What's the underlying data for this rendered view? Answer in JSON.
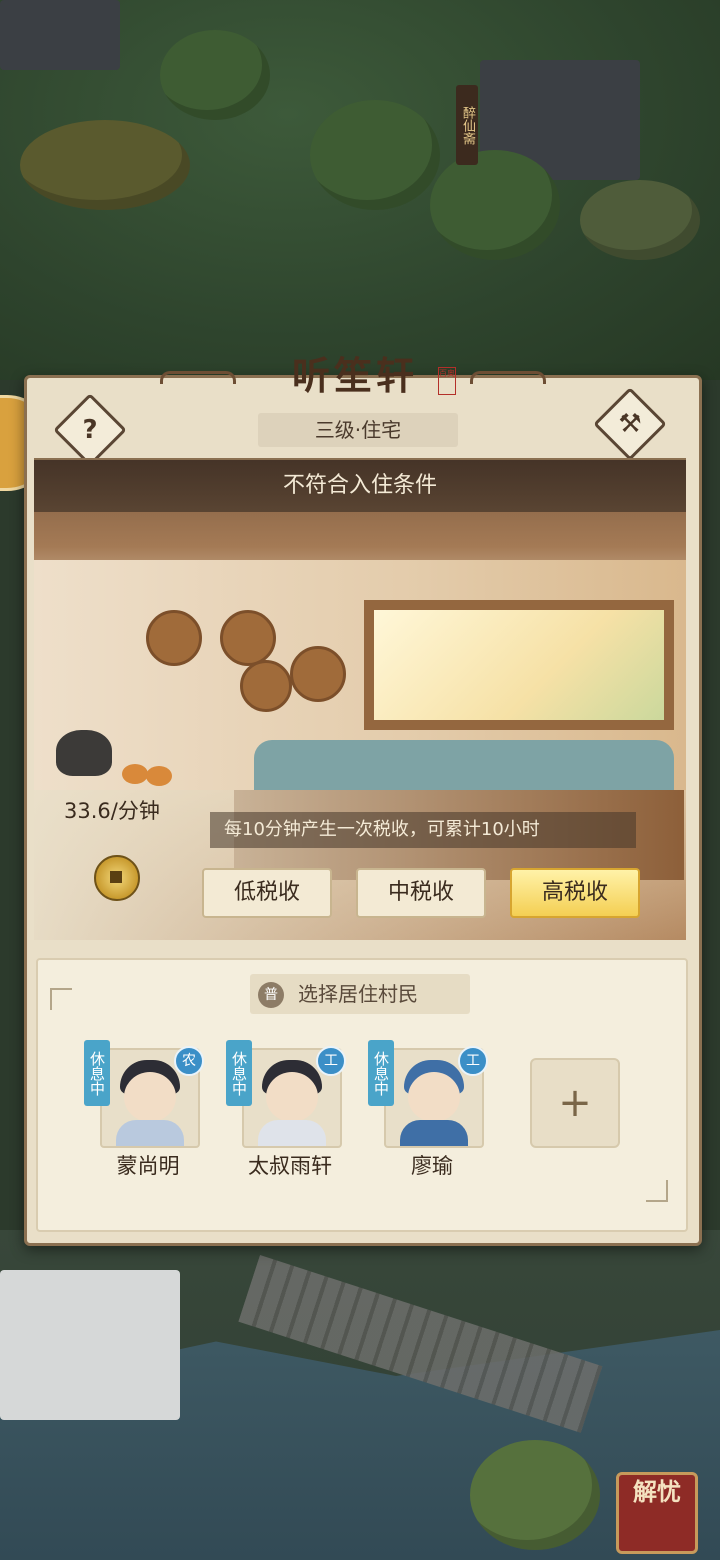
{
  "building": {
    "name": "听笙轩",
    "seal_text": "百奥",
    "level_type": "三级·住宅",
    "status": "不符合入住条件"
  },
  "buttons": {
    "help_symbol": "?",
    "build_symbol": "⚒"
  },
  "map": {
    "sign_text": "醉仙斋"
  },
  "tax": {
    "rate_label": "33.6/分钟",
    "note": "每10分钟产生一次税收，可累计10小时",
    "options": [
      {
        "label": "低税收",
        "selected": false
      },
      {
        "label": "中税收",
        "selected": false
      },
      {
        "label": "高税收",
        "selected": true
      }
    ]
  },
  "residents": {
    "header_badge": "普",
    "header": "选择居住村民",
    "list": [
      {
        "name": "蒙尚明",
        "status": "休息中",
        "job": "农"
      },
      {
        "name": "太叔雨轩",
        "status": "休息中",
        "job": "工"
      },
      {
        "name": "廖瑜",
        "status": "休息中",
        "job": "工"
      }
    ],
    "add_symbol": "+"
  },
  "corner_badge": {
    "text": "解忧"
  },
  "colors": {
    "panel_bg": "#e9dfc8",
    "panel_border": "#8b7051",
    "selected_button": "#f4cf53",
    "rest_tag": "#4aa4c9",
    "job_badge": "#3b8fc7"
  }
}
